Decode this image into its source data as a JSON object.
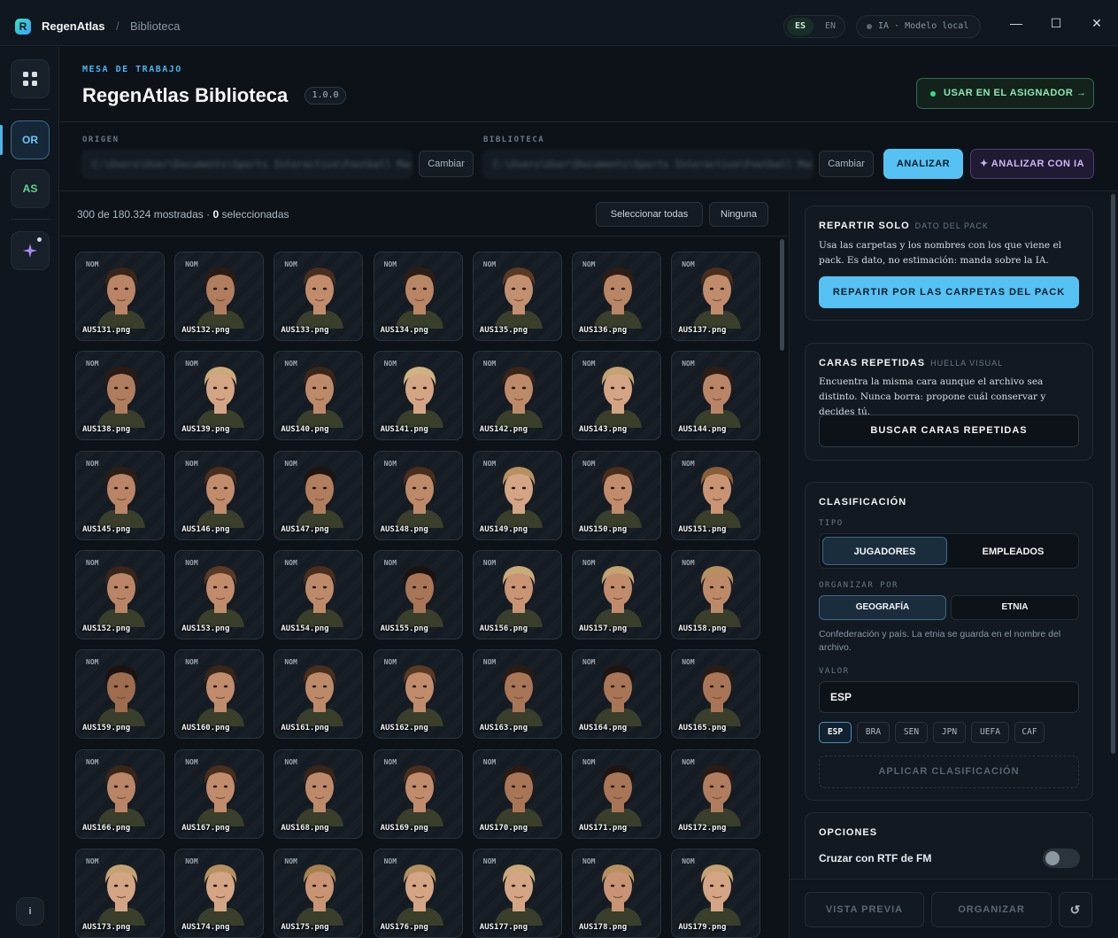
{
  "titlebar": {
    "logo_letter": "R",
    "app_name": "RegenAtlas",
    "separator": "/",
    "breadcrumb": "Biblioteca",
    "lang_es": "ES",
    "lang_en": "EN",
    "ia_status": "IA · Modelo local",
    "minimize": "—",
    "maximize": "☐",
    "close": "✕"
  },
  "rail": {
    "grid_icon": "grid-icon",
    "or_label": "OR",
    "as_label": "AS",
    "sparkle_icon": "sparkle-icon",
    "info_label": "i",
    "colors": {
      "accent": "#4ab5f0",
      "as_color": "#5fd88f",
      "sparkle": "#a98cf5"
    }
  },
  "header": {
    "eyebrow": "MESA DE TRABAJO",
    "title": "RegenAtlas Biblioteca",
    "version": "1.0.0",
    "use_button": "USAR EN EL ASIGNADOR →"
  },
  "source": {
    "origin_label": "ORIGEN",
    "origin_value": "C:\\Users\\User\\Documents\\Sports Interactive\\Football Manager\\graphics",
    "change_label": "Cambiar",
    "library_label": "BIBLIOTECA",
    "library_value": "C:\\Users\\User\\Documents\\Sports Interactive\\Football Manager\\library",
    "change_label_2": "Cambiar",
    "analyze": "ANALIZAR",
    "analyze_ai": "✦ ANALIZAR CON IA"
  },
  "gallery": {
    "shown": "300 de 180.324 mostradas · ",
    "selected_count": "0",
    "selected_suffix": " seleccionadas",
    "select_all": "Seleccionar todas",
    "none": "Ninguna",
    "tag": "NOM",
    "tiles": [
      {
        "file": "AUS131.png",
        "skin": "#b98566",
        "hair": "#3a2519"
      },
      {
        "file": "AUS132.png",
        "skin": "#b07d5e",
        "hair": "#2a1c14"
      },
      {
        "file": "AUS133.png",
        "skin": "#c08c6c",
        "hair": "#4a2e1c"
      },
      {
        "file": "AUS134.png",
        "skin": "#b88565",
        "hair": "#2d1e15"
      },
      {
        "file": "AUS135.png",
        "skin": "#c29070",
        "hair": "#5a3a22"
      },
      {
        "file": "AUS136.png",
        "skin": "#b88565",
        "hair": "#2d1e15"
      },
      {
        "file": "AUS137.png",
        "skin": "#c08c6c",
        "hair": "#4a2e1c"
      },
      {
        "file": "AUS138.png",
        "skin": "#b07d5e",
        "hair": "#2a1c14"
      },
      {
        "file": "AUS139.png",
        "skin": "#d4a584",
        "hair": "#c9aa78"
      },
      {
        "file": "AUS140.png",
        "skin": "#bd8a69",
        "hair": "#3a2519"
      },
      {
        "file": "AUS141.png",
        "skin": "#d4a584",
        "hair": "#d0b282"
      },
      {
        "file": "AUS142.png",
        "skin": "#bd8a69",
        "hair": "#3a2519"
      },
      {
        "file": "AUS143.png",
        "skin": "#d4a584",
        "hair": "#c4a272"
      },
      {
        "file": "AUS144.png",
        "skin": "#b98566",
        "hair": "#2d1e15"
      },
      {
        "file": "AUS145.png",
        "skin": "#b98566",
        "hair": "#2d1e15"
      },
      {
        "file": "AUS146.png",
        "skin": "#c08c6c",
        "hair": "#4a2e1c"
      },
      {
        "file": "AUS147.png",
        "skin": "#b07d5e",
        "hair": "#1e1510"
      },
      {
        "file": "AUS148.png",
        "skin": "#bd8a69",
        "hair": "#4a2e1c"
      },
      {
        "file": "AUS149.png",
        "skin": "#d4a584",
        "hair": "#b79060"
      },
      {
        "file": "AUS150.png",
        "skin": "#c08c6c",
        "hair": "#4a2e1c"
      },
      {
        "file": "AUS151.png",
        "skin": "#c89474",
        "hair": "#8a5e36"
      },
      {
        "file": "AUS152.png",
        "skin": "#b98566",
        "hair": "#3a2519"
      },
      {
        "file": "AUS153.png",
        "skin": "#c08c6c",
        "hair": "#5a3a22"
      },
      {
        "file": "AUS154.png",
        "skin": "#bd8a69",
        "hair": "#4a2e1c"
      },
      {
        "file": "AUS155.png",
        "skin": "#a87656",
        "hair": "#1a1310"
      },
      {
        "file": "AUS156.png",
        "skin": "#c89474",
        "hair": "#c9aa78"
      },
      {
        "file": "AUS157.png",
        "skin": "#c08c6c",
        "hair": "#c4a272"
      },
      {
        "file": "AUS158.png",
        "skin": "#bd8a69",
        "hair": "#b79060"
      },
      {
        "file": "AUS159.png",
        "skin": "#9e6c4e",
        "hair": "#1a1310"
      },
      {
        "file": "AUS160.png",
        "skin": "#c08c6c",
        "hair": "#3a2519"
      },
      {
        "file": "AUS161.png",
        "skin": "#bd8a69",
        "hair": "#4a2e1c"
      },
      {
        "file": "AUS162.png",
        "skin": "#c08c6c",
        "hair": "#5a3a22"
      },
      {
        "file": "AUS163.png",
        "skin": "#a87656",
        "hair": "#2a1c14"
      },
      {
        "file": "AUS164.png",
        "skin": "#a87656",
        "hair": "#1e1510"
      },
      {
        "file": "AUS165.png",
        "skin": "#a87656",
        "hair": "#2a1c14"
      },
      {
        "file": "AUS166.png",
        "skin": "#b98566",
        "hair": "#3a2519"
      },
      {
        "file": "AUS167.png",
        "skin": "#c08c6c",
        "hair": "#4a2e1c"
      },
      {
        "file": "AUS168.png",
        "skin": "#bd8a69",
        "hair": "#3a2519"
      },
      {
        "file": "AUS169.png",
        "skin": "#c08c6c",
        "hair": "#4a2e1c"
      },
      {
        "file": "AUS170.png",
        "skin": "#a87656",
        "hair": "#2a1c14"
      },
      {
        "file": "AUS171.png",
        "skin": "#a87656",
        "hair": "#1e1510"
      },
      {
        "file": "AUS172.png",
        "skin": "#b07d5e",
        "hair": "#2a1c14"
      },
      {
        "file": "AUS173.png",
        "skin": "#d4a584",
        "hair": "#c4a272"
      },
      {
        "file": "AUS174.png",
        "skin": "#d4a584",
        "hair": "#b79060"
      },
      {
        "file": "AUS175.png",
        "skin": "#c89474",
        "hair": "#a88050"
      },
      {
        "file": "AUS176.png",
        "skin": "#d4a584",
        "hair": "#b79060"
      },
      {
        "file": "AUS177.png",
        "skin": "#d4a584",
        "hair": "#c9aa78"
      },
      {
        "file": "AUS178.png",
        "skin": "#c89474",
        "hair": "#b79060"
      },
      {
        "file": "AUS179.png",
        "skin": "#d4a584",
        "hair": "#c4a272"
      }
    ]
  },
  "panel": {
    "split": {
      "title": "REPARTIR SOLO",
      "sub": "DATO DEL PACK",
      "text": "Usa las carpetas y los nombres con los que viene el pack. Es dato, no estimación: manda sobre la IA.",
      "button": "REPARTIR POR LAS CARPETAS DEL PACK"
    },
    "dupes": {
      "title": "CARAS REPETIDAS",
      "sub": "HUELLA VISUAL",
      "text": "Encuentra la misma cara aunque el archivo sea distinto. Nunca borra: propone cuál conservar y decides tú.",
      "button": "BUSCAR CARAS REPETIDAS"
    },
    "classify": {
      "title": "CLASIFICACIÓN",
      "type_label": "TIPO",
      "type_options": [
        "JUGADORES",
        "EMPLEADOS"
      ],
      "organize_label": "ORGANIZAR POR",
      "organize_options": [
        "GEOGRAFÍA",
        "ETNIA"
      ],
      "hint": "Confederación y país. La etnia se guarda en el nombre del archivo.",
      "value_label": "VALOR",
      "value": "ESP",
      "chips": [
        "ESP",
        "BRA",
        "SEN",
        "JPN",
        "UEFA",
        "CAF"
      ],
      "apply": "APLICAR CLASIFICACIÓN"
    },
    "options": {
      "title": "OPCIONES",
      "toggle_label": "Cruzar con RTF de FM",
      "toggle_on": false
    },
    "footer": {
      "preview": "VISTA PREVIA",
      "organize": "ORGANIZAR",
      "refresh_icon": "↺"
    }
  }
}
